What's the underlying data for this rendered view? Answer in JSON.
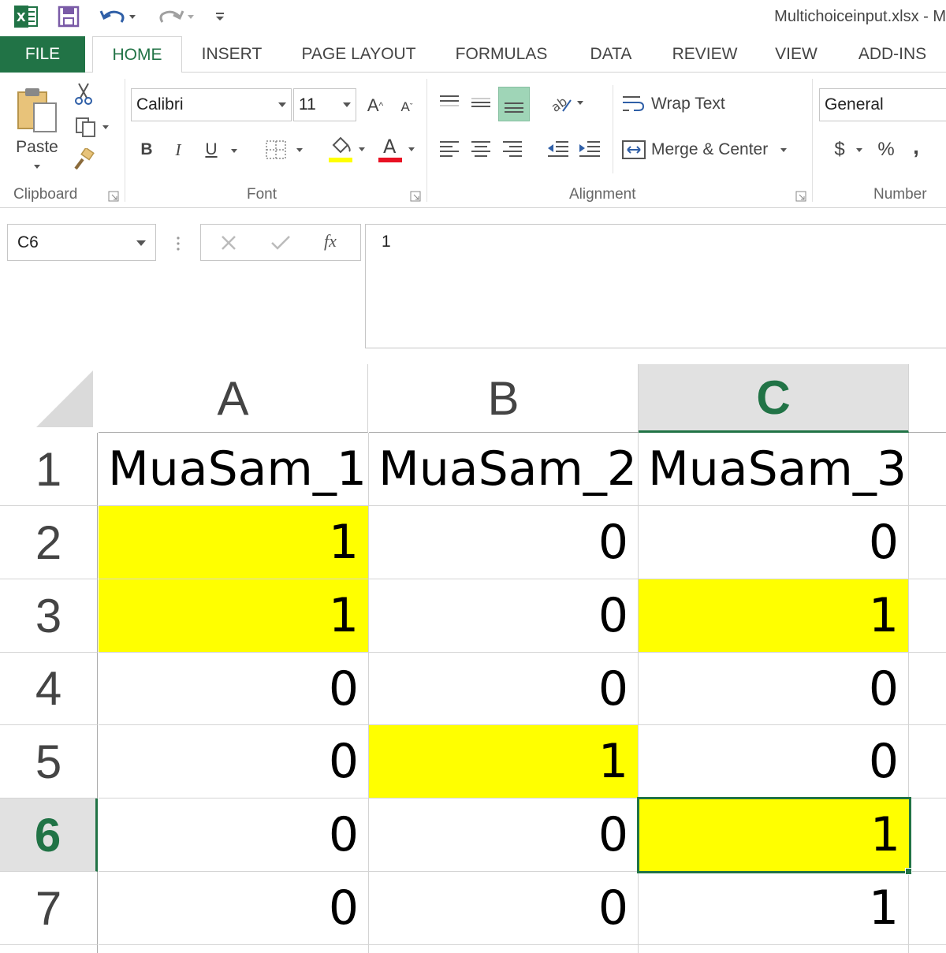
{
  "title_bar": {
    "title": "Multichoiceinput.xlsx - M",
    "icons": [
      "excel-logo-icon",
      "save-icon",
      "undo-icon",
      "redo-icon",
      "customize-qat-icon"
    ]
  },
  "ribbon": {
    "tabs": [
      {
        "label": "FILE"
      },
      {
        "label": "HOME"
      },
      {
        "label": "INSERT"
      },
      {
        "label": "PAGE LAYOUT"
      },
      {
        "label": "FORMULAS"
      },
      {
        "label": "DATA"
      },
      {
        "label": "REVIEW"
      },
      {
        "label": "VIEW"
      },
      {
        "label": "ADD-INS"
      }
    ],
    "active_tab": "HOME",
    "clipboard": {
      "label": "Clipboard",
      "paste_label": "Paste"
    },
    "font": {
      "label": "Font",
      "font_name": "Calibri",
      "font_size": "11",
      "bold": "B",
      "italic": "I",
      "underline": "U"
    },
    "alignment": {
      "label": "Alignment",
      "wrap_text": "Wrap Text",
      "merge_center": "Merge & Center"
    },
    "number": {
      "label": "Number",
      "format": "General",
      "currency": "$",
      "percent": "%",
      "comma": ","
    }
  },
  "formula_bar": {
    "name_box": "C6",
    "fx_label": "fx",
    "value": "1"
  },
  "sheet": {
    "columns": [
      "A",
      "B",
      "C"
    ],
    "selected_column": "C",
    "selected_row": "6",
    "rows": [
      {
        "row": "1",
        "cells": [
          "MuaSam_1",
          "MuaSam_2",
          "MuaSam_3"
        ]
      },
      {
        "row": "2",
        "cells": [
          "1",
          "0",
          "0"
        ]
      },
      {
        "row": "3",
        "cells": [
          "1",
          "0",
          "1"
        ]
      },
      {
        "row": "4",
        "cells": [
          "0",
          "0",
          "0"
        ]
      },
      {
        "row": "5",
        "cells": [
          "0",
          "1",
          "0"
        ]
      },
      {
        "row": "6",
        "cells": [
          "0",
          "0",
          "1"
        ]
      },
      {
        "row": "7",
        "cells": [
          "0",
          "0",
          "1"
        ]
      }
    ],
    "highlight_color": "#ffff00",
    "accent_color": "#217346"
  }
}
